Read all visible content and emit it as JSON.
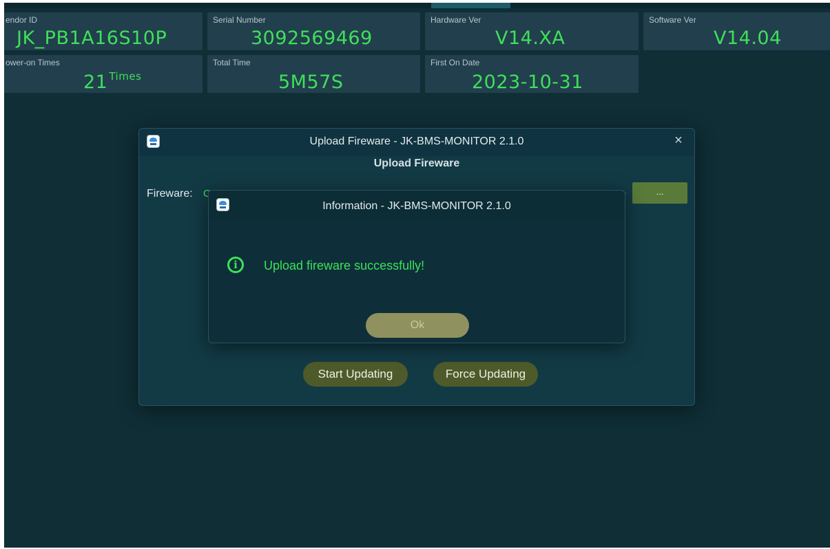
{
  "cards": {
    "vendor_id": {
      "label": "endor ID",
      "value": "JK_PB1A16S10P"
    },
    "serial_number": {
      "label": "Serial Number",
      "value": "3092569469"
    },
    "hardware_ver": {
      "label": "Hardware Ver",
      "value": "V14.XA"
    },
    "software_ver": {
      "label": "Software Ver",
      "value": "V14.04"
    },
    "power_on_times": {
      "label": "ower-on Times",
      "value": "21",
      "unit": "Times"
    },
    "total_time": {
      "label": "Total Time",
      "value": "5M57S"
    },
    "first_on_date": {
      "label": "First On Date",
      "value": "2023-10-31"
    }
  },
  "upload_dialog": {
    "title": "Upload Fireware - JK-BMS-MONITOR 2.1.0",
    "section_title": "Upload Fireware",
    "fireware_label": "Fireware:",
    "fireware_path": "C:/",
    "browse_label": "...",
    "start_label": "Start Updating",
    "force_label": "Force Updating"
  },
  "info_dialog": {
    "title": "Information - JK-BMS-MONITOR 2.1.0",
    "message": "Upload fireware successfully!",
    "info_glyph": "i",
    "ok_label": "Ok"
  },
  "icons": {
    "close": "×",
    "app_icon": "cloud-app-icon",
    "info_icon": "info-circle-icon"
  },
  "colors": {
    "background": "#0f2e36",
    "card": "#223f4d",
    "value_green": "#3ee05a",
    "button_olive": "#4f5a2a"
  }
}
